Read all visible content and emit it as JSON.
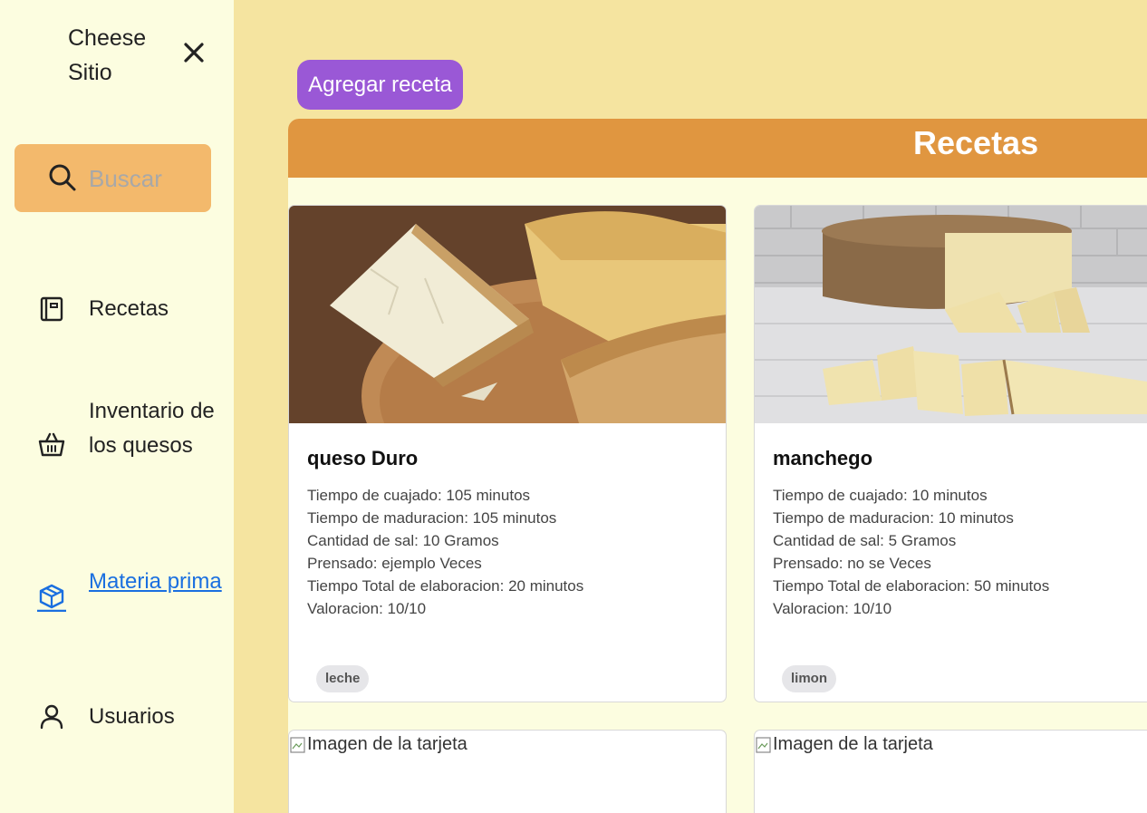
{
  "sidebar": {
    "brand": "Cheese Sitio",
    "search_placeholder": "Buscar",
    "items": [
      {
        "label": "Recetas",
        "icon": "book-icon"
      },
      {
        "label": "Inventario de los quesos",
        "icon": "basket-icon"
      },
      {
        "label": "Materia prima",
        "icon": "box-icon",
        "active": true
      },
      {
        "label": "Usuarios",
        "icon": "user-icon"
      }
    ]
  },
  "main": {
    "add_button": "Agregar receta",
    "header": "Recetas",
    "cards": [
      {
        "title": "queso Duro",
        "details": [
          "Tiempo de cuajado: 105 minutos",
          "Tiempo de maduracion: 105 minutos",
          "Cantidad de sal: 10 Gramos",
          "Prensado: ejemplo Veces",
          "Tiempo Total de elaboracion: 20 minutos",
          "Valoracion: 10/10"
        ],
        "tag": "leche"
      },
      {
        "title": "manchego",
        "details": [
          "Tiempo de cuajado: 10 minutos",
          "Tiempo de maduracion: 10 minutos",
          "Cantidad de sal: 5 Gramos",
          "Prensado: no se Veces",
          "Tiempo Total de elaboracion: 50 minutos",
          "Valoracion: 10/10"
        ],
        "tag": "limon"
      }
    ],
    "broken_image_alt": "Imagen de la tarjeta"
  },
  "colors": {
    "page_bg": "#f5e4a0",
    "sidebar_bg": "#fcfde0",
    "search_bg": "#f3b96c",
    "header_bg": "#e09640",
    "button_bg": "#9a58d6",
    "active_link": "#1a6fe0"
  }
}
